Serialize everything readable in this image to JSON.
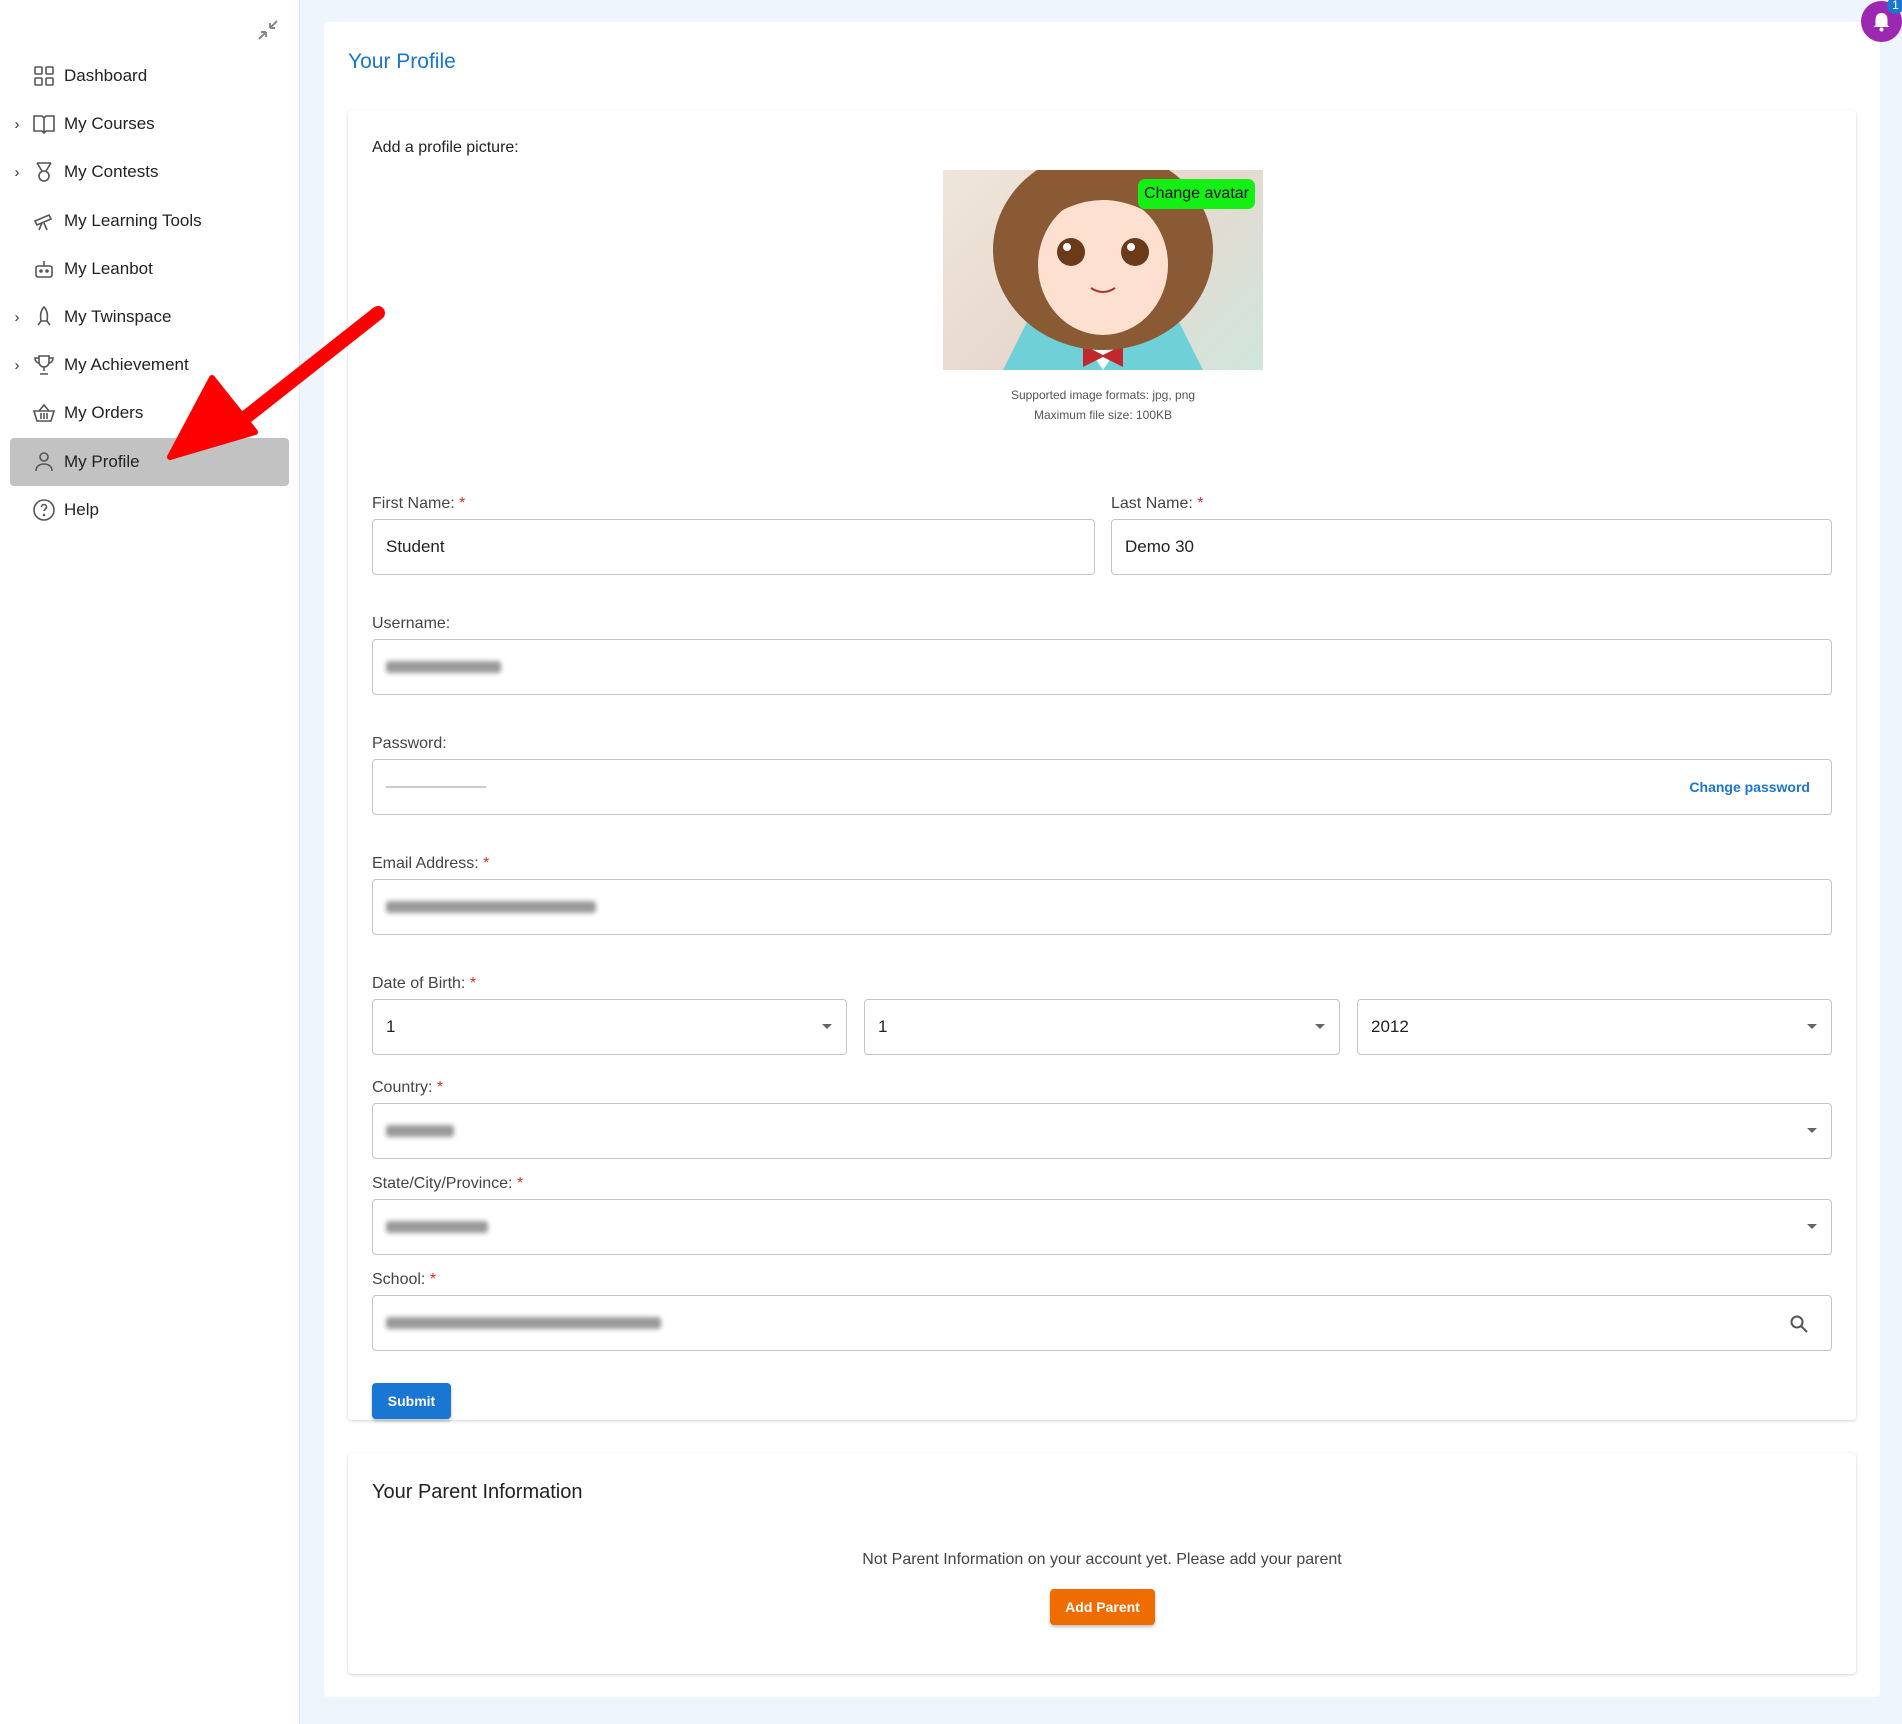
{
  "sidebar": {
    "items": [
      {
        "label": "Dashboard",
        "icon": "dashboard-icon",
        "expandable": false
      },
      {
        "label": "My Courses",
        "icon": "book-icon",
        "expandable": true
      },
      {
        "label": "My Contests",
        "icon": "medal-icon",
        "expandable": true
      },
      {
        "label": "My Learning Tools",
        "icon": "telescope-icon",
        "expandable": false
      },
      {
        "label": "My Leanbot",
        "icon": "robot-icon",
        "expandable": false
      },
      {
        "label": "My Twinspace",
        "icon": "rocket-icon",
        "expandable": true
      },
      {
        "label": "My Achievement",
        "icon": "trophy-icon",
        "expandable": true
      },
      {
        "label": "My Orders",
        "icon": "basket-icon",
        "expandable": false
      },
      {
        "label": "My Profile",
        "icon": "user-icon",
        "expandable": false,
        "active": true
      },
      {
        "label": "Help",
        "icon": "help-icon",
        "expandable": false
      }
    ]
  },
  "notifications": {
    "count": "1",
    "color": "#9c27b0"
  },
  "profile": {
    "title": "Your Profile",
    "picture_label": "Add a profile picture:",
    "change_avatar": "Change avatar",
    "formats": "Supported image formats: jpg, png",
    "max_size": "Maximum file size: 100KB",
    "first_name_label": "First Name:",
    "first_name": "Student",
    "last_name_label": "Last Name:",
    "last_name": "Demo 30",
    "username_label": "Username:",
    "password_label": "Password:",
    "change_password": "Change password",
    "email_label": "Email Address:",
    "dob_label": "Date of Birth:",
    "dob_day": "1",
    "dob_month": "1",
    "dob_year": "2012",
    "country_label": "Country:",
    "state_label": "State/City/Province:",
    "school_label": "School:",
    "required": "*",
    "submit": "Submit"
  },
  "parent": {
    "title": "Your Parent Information",
    "empty_text": "Not Parent Information on your account yet. Please add your parent",
    "add_button": "Add Parent"
  },
  "colors": {
    "primary": "#1976d2",
    "accent_orange": "#ef6c00",
    "avatar_button": "#14f014",
    "arrow": "#ff0000"
  }
}
